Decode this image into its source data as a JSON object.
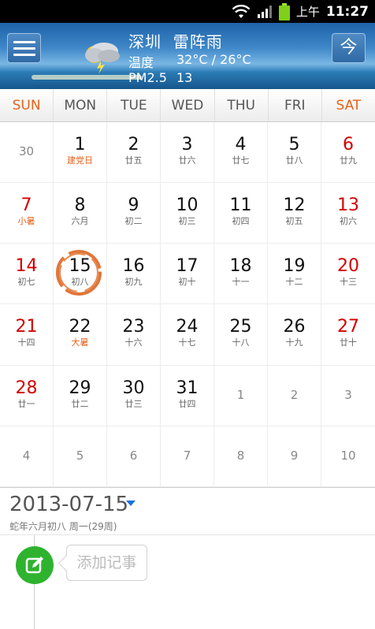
{
  "status_bar": {
    "ampm": "上午",
    "time": "11:27"
  },
  "weather": {
    "city": "深圳",
    "condition": "雷阵雨",
    "temp_label": "温度",
    "temp": "32°C / 26°C",
    "pm_label": "PM2.5",
    "pm": "13",
    "icon": "thunderstorm-icon"
  },
  "toolbar": {
    "today_label": "今"
  },
  "weekdays": [
    "SUN",
    "MON",
    "TUE",
    "WED",
    "THU",
    "FRI",
    "SAT"
  ],
  "weeks": [
    [
      {
        "day": "30",
        "lunar": "",
        "other": true
      },
      {
        "day": "1",
        "lunar": "建党日",
        "festival": true
      },
      {
        "day": "2",
        "lunar": "廿五"
      },
      {
        "day": "3",
        "lunar": "廿六"
      },
      {
        "day": "4",
        "lunar": "廿七"
      },
      {
        "day": "5",
        "lunar": "廿八"
      },
      {
        "day": "6",
        "lunar": "廿九"
      }
    ],
    [
      {
        "day": "7",
        "lunar": "小暑",
        "festival": true
      },
      {
        "day": "8",
        "lunar": "六月"
      },
      {
        "day": "9",
        "lunar": "初二"
      },
      {
        "day": "10",
        "lunar": "初三"
      },
      {
        "day": "11",
        "lunar": "初四"
      },
      {
        "day": "12",
        "lunar": "初五"
      },
      {
        "day": "13",
        "lunar": "初六"
      }
    ],
    [
      {
        "day": "14",
        "lunar": "初七"
      },
      {
        "day": "15",
        "lunar": "初八",
        "today": true
      },
      {
        "day": "16",
        "lunar": "初九"
      },
      {
        "day": "17",
        "lunar": "初十"
      },
      {
        "day": "18",
        "lunar": "十一"
      },
      {
        "day": "19",
        "lunar": "十二"
      },
      {
        "day": "20",
        "lunar": "十三"
      }
    ],
    [
      {
        "day": "21",
        "lunar": "十四"
      },
      {
        "day": "22",
        "lunar": "大暑",
        "festival": true
      },
      {
        "day": "23",
        "lunar": "十六"
      },
      {
        "day": "24",
        "lunar": "十七"
      },
      {
        "day": "25",
        "lunar": "十八"
      },
      {
        "day": "26",
        "lunar": "十九"
      },
      {
        "day": "27",
        "lunar": "廿十"
      }
    ],
    [
      {
        "day": "28",
        "lunar": "廿一"
      },
      {
        "day": "29",
        "lunar": "廿二"
      },
      {
        "day": "30",
        "lunar": "廿三"
      },
      {
        "day": "31",
        "lunar": "廿四"
      },
      {
        "day": "1",
        "lunar": "",
        "other": true
      },
      {
        "day": "2",
        "lunar": "",
        "other": true
      },
      {
        "day": "3",
        "lunar": "",
        "other": true
      }
    ],
    [
      {
        "day": "4",
        "lunar": "",
        "other": true
      },
      {
        "day": "5",
        "lunar": "",
        "other": true
      },
      {
        "day": "6",
        "lunar": "",
        "other": true
      },
      {
        "day": "7",
        "lunar": "",
        "other": true
      },
      {
        "day": "8",
        "lunar": "",
        "other": true
      },
      {
        "day": "9",
        "lunar": "",
        "other": true
      },
      {
        "day": "10",
        "lunar": "",
        "other": true
      }
    ]
  ],
  "selected": {
    "date": "2013-07-15",
    "detail": "蛇年六月初八 周一(29周)"
  },
  "notes": {
    "add_label": "添加记事"
  },
  "colors": {
    "weekend": "#d40000",
    "festival": "#e8611a",
    "accent": "#2fb32f"
  }
}
